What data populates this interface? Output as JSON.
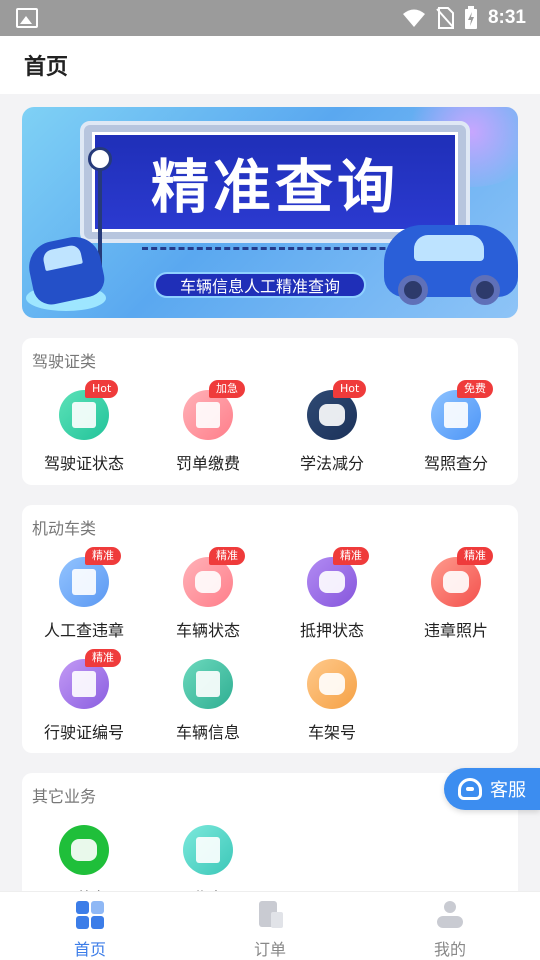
{
  "status_bar": {
    "time": "8:31"
  },
  "header": {
    "title": "首页"
  },
  "banner": {
    "headline": "精准查询",
    "caption": "车辆信息人工精准查询"
  },
  "sections": {
    "license": {
      "title": "驾驶证类",
      "items": [
        {
          "label": "驾驶证状态",
          "badge": "Hot",
          "icon": "license-status-icon"
        },
        {
          "label": "罚单缴费",
          "badge": "加急",
          "icon": "ticket-payment-icon"
        },
        {
          "label": "学法减分",
          "badge": "Hot",
          "icon": "study-icon"
        },
        {
          "label": "驾照查分",
          "badge": "免费",
          "icon": "license-score-icon"
        }
      ]
    },
    "vehicle": {
      "title": "机动车类",
      "items": [
        {
          "label": "人工查违章",
          "badge": "精准",
          "icon": "violation-query-icon"
        },
        {
          "label": "车辆状态",
          "badge": "精准",
          "icon": "vehicle-status-icon"
        },
        {
          "label": "抵押状态",
          "badge": "精准",
          "icon": "mortgage-status-icon"
        },
        {
          "label": "违章照片",
          "badge": "精准",
          "icon": "camera-icon"
        },
        {
          "label": "行驶证编号",
          "badge": "精准",
          "icon": "driving-license-number-icon"
        },
        {
          "label": "车辆信息",
          "badge": "",
          "icon": "vehicle-info-icon"
        },
        {
          "label": "车架号",
          "badge": "",
          "icon": "vin-icon"
        }
      ]
    },
    "other": {
      "title": "其它业务",
      "items": [
        {
          "label": "运营车",
          "icon": "truck-icon"
        },
        {
          "label": "从业人员",
          "icon": "staff-card-icon"
        }
      ]
    }
  },
  "service_button": {
    "label": "客服",
    "icon": "headset-icon"
  },
  "bottom_nav": [
    {
      "label": "首页",
      "active": true,
      "icon": "home-grid-icon"
    },
    {
      "label": "订单",
      "active": false,
      "icon": "order-icon"
    },
    {
      "label": "我的",
      "active": false,
      "icon": "profile-icon"
    }
  ],
  "colors": {
    "accent": "#3c7de8",
    "badge": "#ef3b3b"
  }
}
